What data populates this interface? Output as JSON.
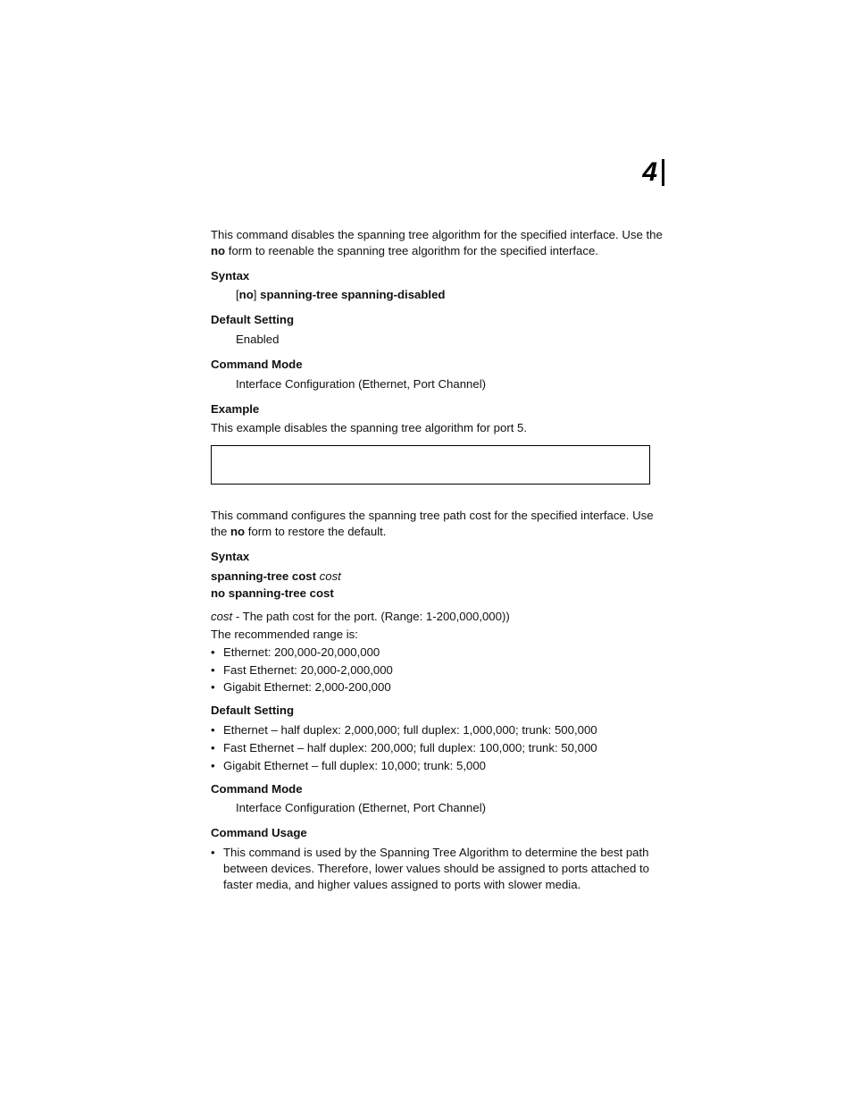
{
  "chapter_number": "4",
  "sec1": {
    "intro_a": "This command disables the spanning tree algorithm for the specified interface. Use the ",
    "intro_no": "no",
    "intro_b": " form to reenable the spanning tree algorithm for the specified interface.",
    "h_syntax": "Syntax",
    "syntax_br_open": "[",
    "syntax_no": "no",
    "syntax_br_close": "] ",
    "syntax_cmd": "spanning-tree spanning-disabled",
    "h_default": "Default Setting",
    "default_val": "Enabled",
    "h_mode": "Command Mode",
    "mode_val": "Interface Configuration (Ethernet, Port Channel)",
    "h_example": "Example",
    "example_text": "This example disables the spanning tree algorithm for port 5."
  },
  "sec2": {
    "intro_a": "This command configures the spanning tree path cost for the specified interface. Use the ",
    "intro_no": "no",
    "intro_b": " form to restore the default.",
    "h_syntax": "Syntax",
    "syntax_line1_cmd": "spanning-tree cost",
    "syntax_line1_arg": "cost",
    "syntax_line2": "no spanning-tree cost",
    "cost_arg": "cost",
    "cost_desc": " - The path cost for the port. (Range: 1-200,000,000))",
    "cost_reco_intro": "The recommended range is:",
    "reco": [
      "Ethernet: 200,000-20,000,000",
      "Fast Ethernet: 20,000-2,000,000",
      "Gigabit Ethernet: 2,000-200,000"
    ],
    "h_default": "Default Setting",
    "defaults": [
      "Ethernet – half duplex: 2,000,000; full duplex: 1,000,000; trunk: 500,000",
      "Fast Ethernet – half duplex: 200,000; full duplex: 100,000; trunk: 50,000",
      "Gigabit Ethernet – full duplex: 10,000; trunk: 5,000"
    ],
    "h_mode": "Command Mode",
    "mode_val": "Interface Configuration (Ethernet, Port Channel)",
    "h_usage": "Command Usage",
    "usage": [
      "This command is used by the Spanning Tree Algorithm to determine the best path between devices. Therefore, lower values should be assigned to ports attached to faster media, and higher values assigned to ports with slower media."
    ]
  }
}
